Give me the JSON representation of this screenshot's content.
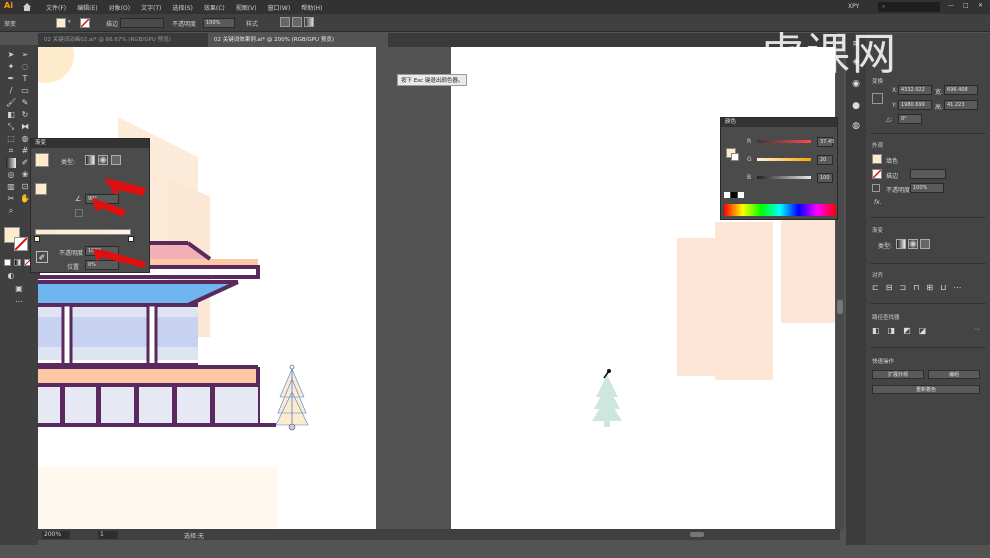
{
  "menubar": {
    "app_logo": "Ai",
    "items": [
      "文件(F)",
      "编辑(E)",
      "对象(O)",
      "文字(T)",
      "选择(S)",
      "效果(C)",
      "视图(V)",
      "窗口(W)",
      "帮助(H)"
    ],
    "workspace": "XPY"
  },
  "control_bar": {
    "label_fill": "渐变",
    "label_stroke": "描边",
    "label_opacity": "不透明度",
    "opacity_value": "100%",
    "label_style": "样式",
    "fill_color": "#fdebcc"
  },
  "doc_tabs": [
    {
      "label": "02 关键词动画02.ai* @ 66.67% (RGB/GPU 预览)",
      "active": false
    },
    {
      "label": "02 关键词效果例.ai* @ 200% (RGB/GPU 预览)",
      "active": true
    }
  ],
  "tooltip": {
    "text": "按下 Esc 键退出颜色器。"
  },
  "gradient_panel": {
    "title": "渐变",
    "type_label": "类型:",
    "angle_value": "90°",
    "opacity_label": "不透明度",
    "opacity_value": "100%",
    "location_label": "位置",
    "location_value": "0%"
  },
  "color_panel": {
    "title": "颜色",
    "channels": [
      {
        "name": "R",
        "value": "37.45",
        "color": "#e85a5a"
      },
      {
        "name": "G",
        "value": "20",
        "color": "#ffa500"
      },
      {
        "name": "B",
        "value": "100",
        "color": "#3a6ee0"
      }
    ]
  },
  "status_bar": {
    "zoom": "200%",
    "page": "1",
    "tool_status": "选择:无"
  },
  "right_panel": {
    "transform_title": "变换",
    "x_label": "X:",
    "x_value": "4332.022",
    "y_label": "Y:",
    "y_value": "1980.699",
    "w_label": "宽:",
    "w_value": "696.408",
    "h_label": "高:",
    "h_value": "41.223",
    "angle_label": "△:",
    "angle_value": "0°",
    "appearance_title": "外观",
    "fill_label": "填色",
    "stroke_label": "描边",
    "opacity_label": "不透明度",
    "opacity_value": "100%",
    "fx_label": "fx.",
    "gradient_title": "渐变",
    "type_label": "类型:",
    "align_title": "对齐",
    "pathfinder_title": "路径查找器",
    "quick_actions_title": "快速操作",
    "buttons": [
      "扩展外观",
      "编组",
      "重新着色"
    ]
  },
  "watermark": "虎课网",
  "colors": {
    "canvas_bg": "#ffffff",
    "pasteboard": "#535353",
    "highlight_red": "#e01010"
  }
}
